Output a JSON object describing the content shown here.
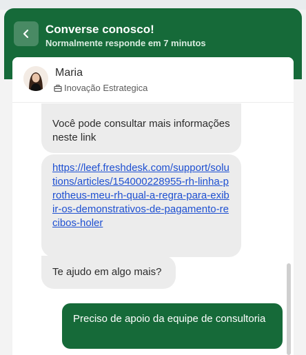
{
  "header": {
    "back_label": "",
    "title": "Converse conosco!",
    "subtitle": "Normalmente responde em 7 minutos"
  },
  "agent": {
    "name": "Maria",
    "team": "Inovação Estrategica"
  },
  "messages": [
    {
      "from": "agent",
      "text": "Você pode consultar mais informações neste link"
    },
    {
      "from": "agent",
      "link": "https://leef.freshdesk.com/support/solutions/articles/154000228955-rh-linha-protheus-meu-rh-qual-a-regra-para-exibir-os-demonstrativos-de-pagamento-recibos-holer"
    },
    {
      "from": "agent",
      "text": "Te ajudo em algo mais?"
    },
    {
      "from": "user",
      "text": "Preciso de apoio da equipe de consultoria"
    }
  ],
  "colors": {
    "brand": "#166a39",
    "agent_bubble": "#ececec",
    "link": "#1d4fd1"
  },
  "icons": {
    "back": "chevron-left-icon",
    "team": "briefcase-icon"
  }
}
